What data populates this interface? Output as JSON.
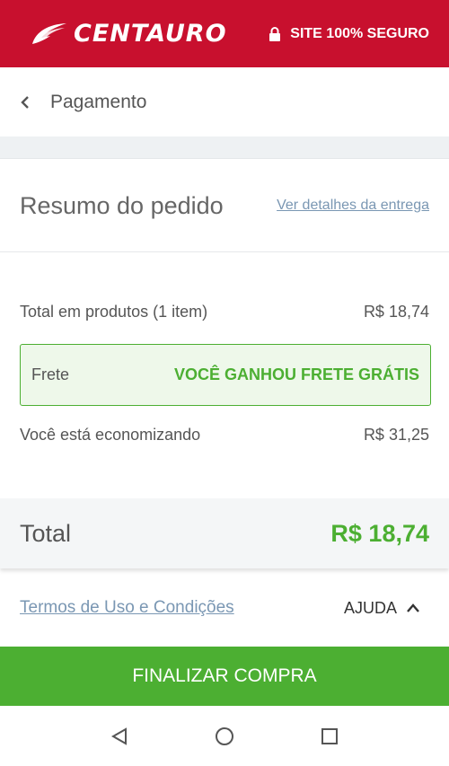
{
  "header": {
    "brand": "CENTAURO",
    "logo_icon": "centauro-swoosh-logo",
    "secure_icon": "lock-icon",
    "secure_label": "SITE 100% SEGURO",
    "color": "#c8102e"
  },
  "nav": {
    "back_icon": "chevron-left-icon",
    "title": "Pagamento"
  },
  "summary": {
    "title": "Resumo do pedido",
    "details_link": "Ver detalhes da entrega"
  },
  "lines": {
    "products_label": "Total em produtos (1 item)",
    "products_value": "R$ 18,74",
    "shipping_label": "Frete",
    "shipping_value": "VOCÊ GANHOU FRETE GRÁTIS",
    "savings_label": "Você está economizando",
    "savings_value": "R$ 31,25"
  },
  "total": {
    "label": "Total",
    "value": "R$ 18,74"
  },
  "footer": {
    "terms_link": "Termos de Uso e Condições",
    "help_label": "AJUDA",
    "help_icon": "chevron-up-icon"
  },
  "cta": {
    "label": "FINALIZAR COMPRA",
    "color": "#4caf32"
  },
  "system_nav": {
    "back_icon": "triangle-back-icon",
    "home_icon": "circle-home-icon",
    "recents_icon": "square-recents-icon"
  }
}
